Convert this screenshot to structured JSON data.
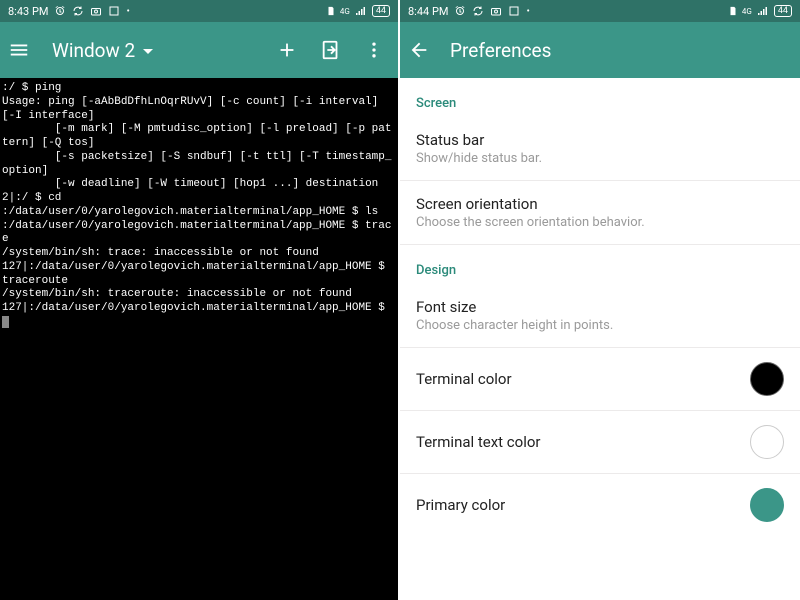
{
  "left": {
    "statusbar": {
      "time": "8:43 PM",
      "battery": "44"
    },
    "appbar": {
      "window_label": "Window 2"
    },
    "terminal_lines": [
      ":/ $ ping",
      "Usage: ping [-aAbBdDfhLnOqrRUvV] [-c count] [-i interval] [-I interface]",
      "        [-m mark] [-M pmtudisc_option] [-l preload] [-p pattern] [-Q tos]",
      "        [-s packetsize] [-S sndbuf] [-t ttl] [-T timestamp_option]",
      "        [-w deadline] [-W timeout] [hop1 ...] destination",
      "2|:/ $ cd",
      ":/data/user/0/yarolegovich.materialterminal/app_HOME $ ls",
      ":/data/user/0/yarolegovich.materialterminal/app_HOME $ trace",
      "/system/bin/sh: trace: inaccessible or not found",
      "127|:/data/user/0/yarolegovich.materialterminal/app_HOME $ traceroute",
      "/system/bin/sh: traceroute: inaccessible or not found",
      "127|:/data/user/0/yarolegovich.materialterminal/app_HOME $ "
    ]
  },
  "right": {
    "statusbar": {
      "time": "8:44 PM",
      "battery": "44"
    },
    "appbar": {
      "title": "Preferences"
    },
    "sections": {
      "screen_header": "Screen",
      "design_header": "Design",
      "status_bar": {
        "title": "Status bar",
        "sub": "Show/hide status bar."
      },
      "orientation": {
        "title": "Screen orientation",
        "sub": "Choose the screen orientation behavior."
      },
      "font_size": {
        "title": "Font size",
        "sub": "Choose character height in points."
      },
      "term_color": {
        "title": "Terminal color"
      },
      "term_text_color": {
        "title": "Terminal text color"
      },
      "primary_color": {
        "title": "Primary color"
      }
    }
  }
}
